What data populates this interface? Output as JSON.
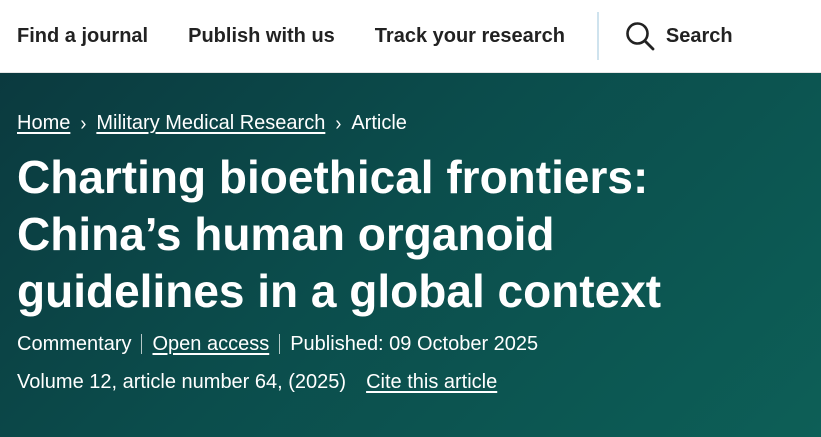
{
  "nav": {
    "items": [
      "Find a journal",
      "Publish with us",
      "Track your research"
    ],
    "search_label": "Search"
  },
  "breadcrumb": {
    "home": "Home",
    "journal": "Military Medical Research",
    "current": "Article"
  },
  "article": {
    "title": "Charting bioethical frontiers: China’s human organoid guidelines in a global context",
    "type": "Commentary",
    "access": "Open access",
    "published": "Published: 09 October 2025",
    "volume": "Volume 12, article number 64, (2025)",
    "cite": "Cite this article"
  },
  "colors": {
    "hero_dark": "#0b3a3f",
    "hero_light": "#0d5f57",
    "nav_text": "#222222"
  }
}
